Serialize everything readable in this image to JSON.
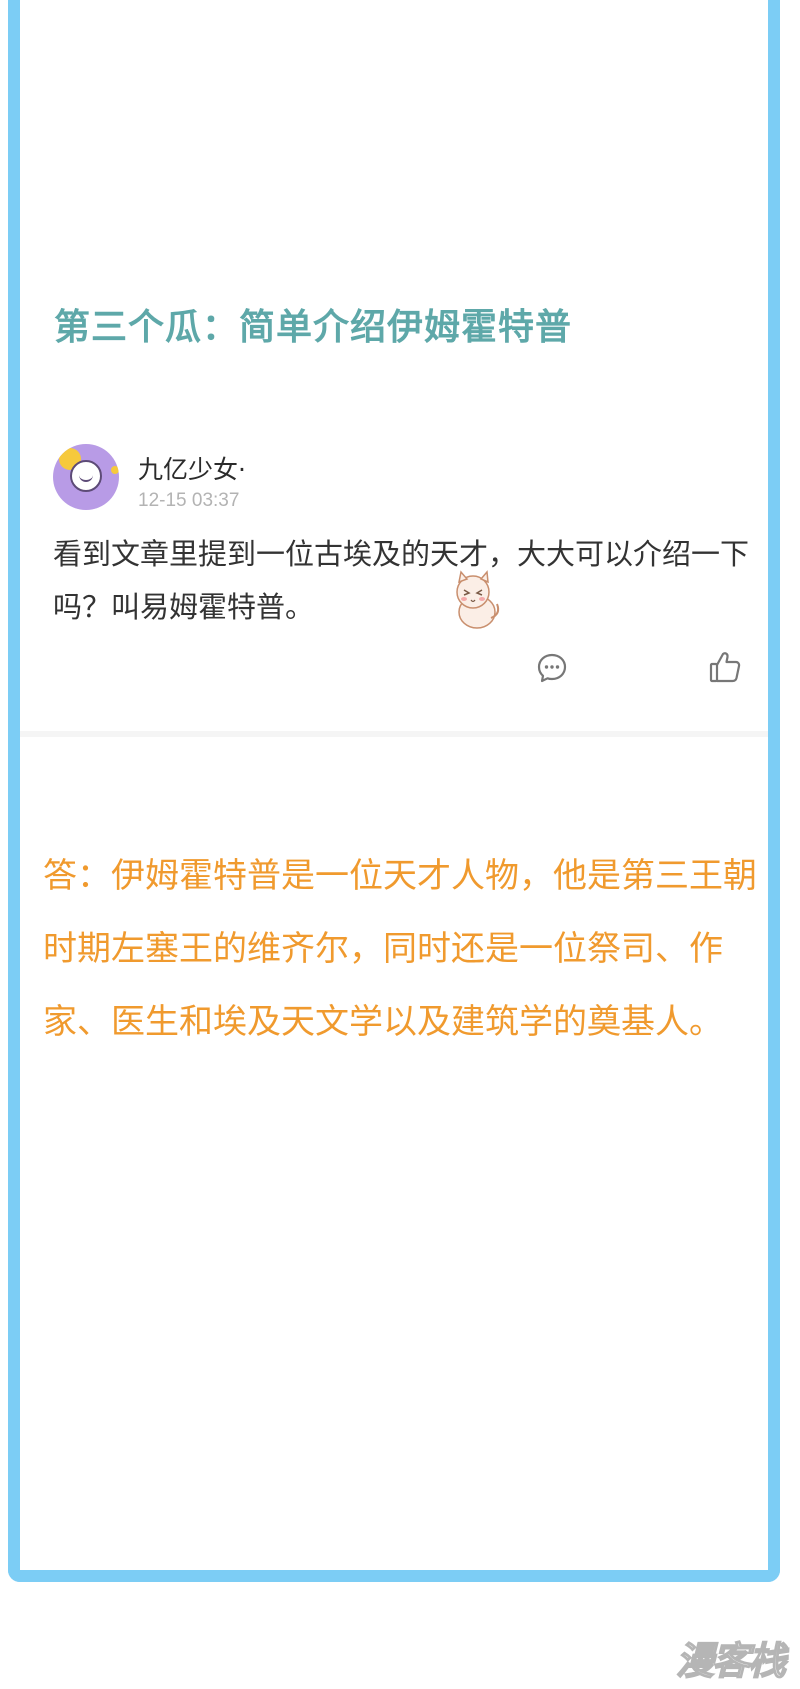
{
  "section": {
    "title": "第三个瓜：简单介绍伊姆霍特普"
  },
  "comment": {
    "username": "九亿少女·",
    "timestamp": "12-15 03:37",
    "text": "看到文章里提到一位古埃及的天才，大大可以介绍一下吗？叫易姆霍特普。",
    "sticker": "cat-sticker",
    "reply_icon": "comment-bubble-icon",
    "like_icon": "thumbs-up-icon"
  },
  "answer": {
    "text": "答：伊姆霍特普是一位天才人物，他是第三王朝时期左塞王的维齐尔，同时还是一位祭司、作家、医生和埃及天文学以及建筑学的奠基人。"
  },
  "watermark": {
    "text": "漫客栈"
  },
  "colors": {
    "frame": "#7ccdf5",
    "title": "#5ea8a9",
    "answer": "#f09a2e",
    "avatar": "#b89be6"
  }
}
